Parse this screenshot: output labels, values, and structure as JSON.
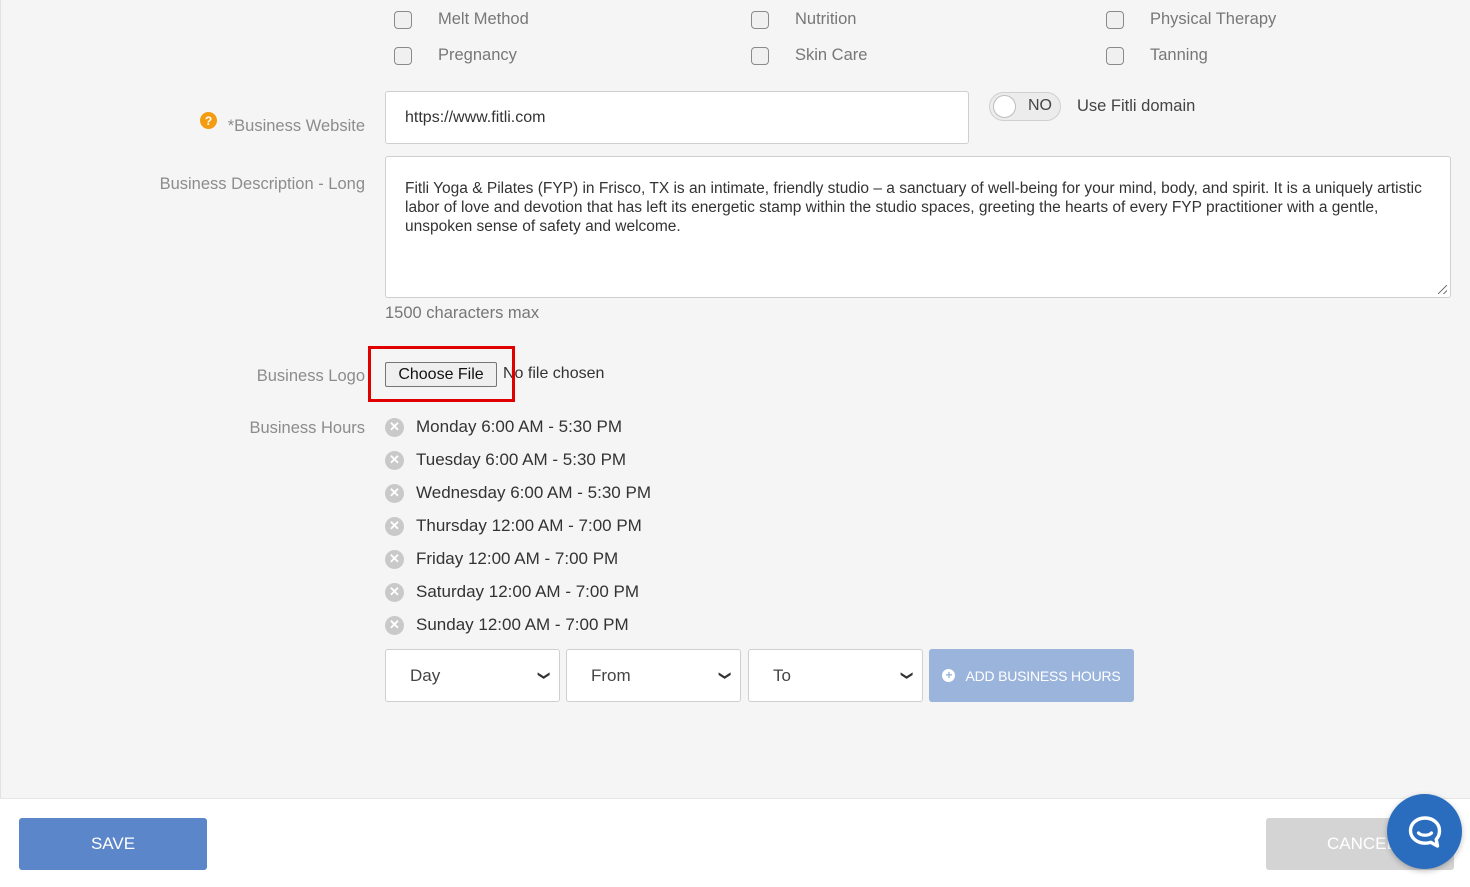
{
  "categories": [
    {
      "label": "Melt Method",
      "checked": false
    },
    {
      "label": "Nutrition",
      "checked": false
    },
    {
      "label": "Physical Therapy",
      "checked": false
    },
    {
      "label": "Pregnancy",
      "checked": false
    },
    {
      "label": "Skin Care",
      "checked": false
    },
    {
      "label": "Tanning",
      "checked": false
    }
  ],
  "website": {
    "label": "*Business Website",
    "value": "https://www.fitli.com",
    "toggle_state": "NO",
    "toggle_label": "Use Fitli domain"
  },
  "description": {
    "label": "Business Description - Long",
    "value": "Fitli Yoga & Pilates (FYP) in Frisco, TX  is an intimate, friendly studio – a sanctuary of well-being for your mind, body, and spirit.  It is a uniquely artistic labor of love and devotion that has left its energetic stamp within the studio spaces, greeting the hearts of every FYP practitioner with a gentle, unspoken sense of safety and welcome.",
    "limit_note": "1500 characters max"
  },
  "logo": {
    "label": "Business Logo",
    "button_label": "Choose File",
    "status": "No file chosen"
  },
  "hours": {
    "label": "Business Hours",
    "entries": [
      "Monday 6:00 AM - 5:30 PM",
      "Tuesday 6:00 AM - 5:30 PM",
      "Wednesday 6:00 AM - 5:30 PM",
      "Thursday 12:00 AM - 7:00 PM",
      "Friday 12:00 AM - 7:00 PM",
      "Saturday 12:00 AM - 7:00 PM",
      "Sunday 12:00 AM - 7:00 PM"
    ],
    "day_select": "Day",
    "from_select": "From",
    "to_select": "To",
    "add_button": "ADD BUSINESS HOURS"
  },
  "footer": {
    "save_label": "SAVE",
    "cancel_label": "CANCEL"
  },
  "colors": {
    "primary": "#5b86c9",
    "add_button": "#9ab4dc",
    "highlight": "#e00000",
    "help": "#f39c12",
    "chat": "#2a6dbe"
  }
}
